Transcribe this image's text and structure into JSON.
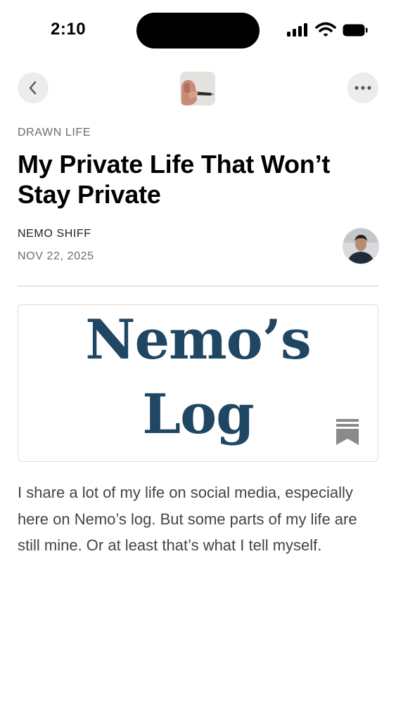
{
  "status_bar": {
    "time": "2:10"
  },
  "nav": {
    "back_icon": "chevron-left-icon",
    "more_icon": "ellipsis-icon",
    "publication_thumb": "pen-in-hand-image"
  },
  "article": {
    "kicker": "DRAWN LIFE",
    "title": "My Private Life That Won’t Stay Private",
    "author": "NEMO SHIFF",
    "date": "NOV 22, 2025",
    "logo": {
      "line1": "Nemo’s",
      "line2": "Log",
      "color": "#1f4763"
    },
    "body": "I share a lot of my life on social media, especially here on Nemo’s log. But some parts of my life are still mine. Or at least that’s what I tell myself."
  }
}
